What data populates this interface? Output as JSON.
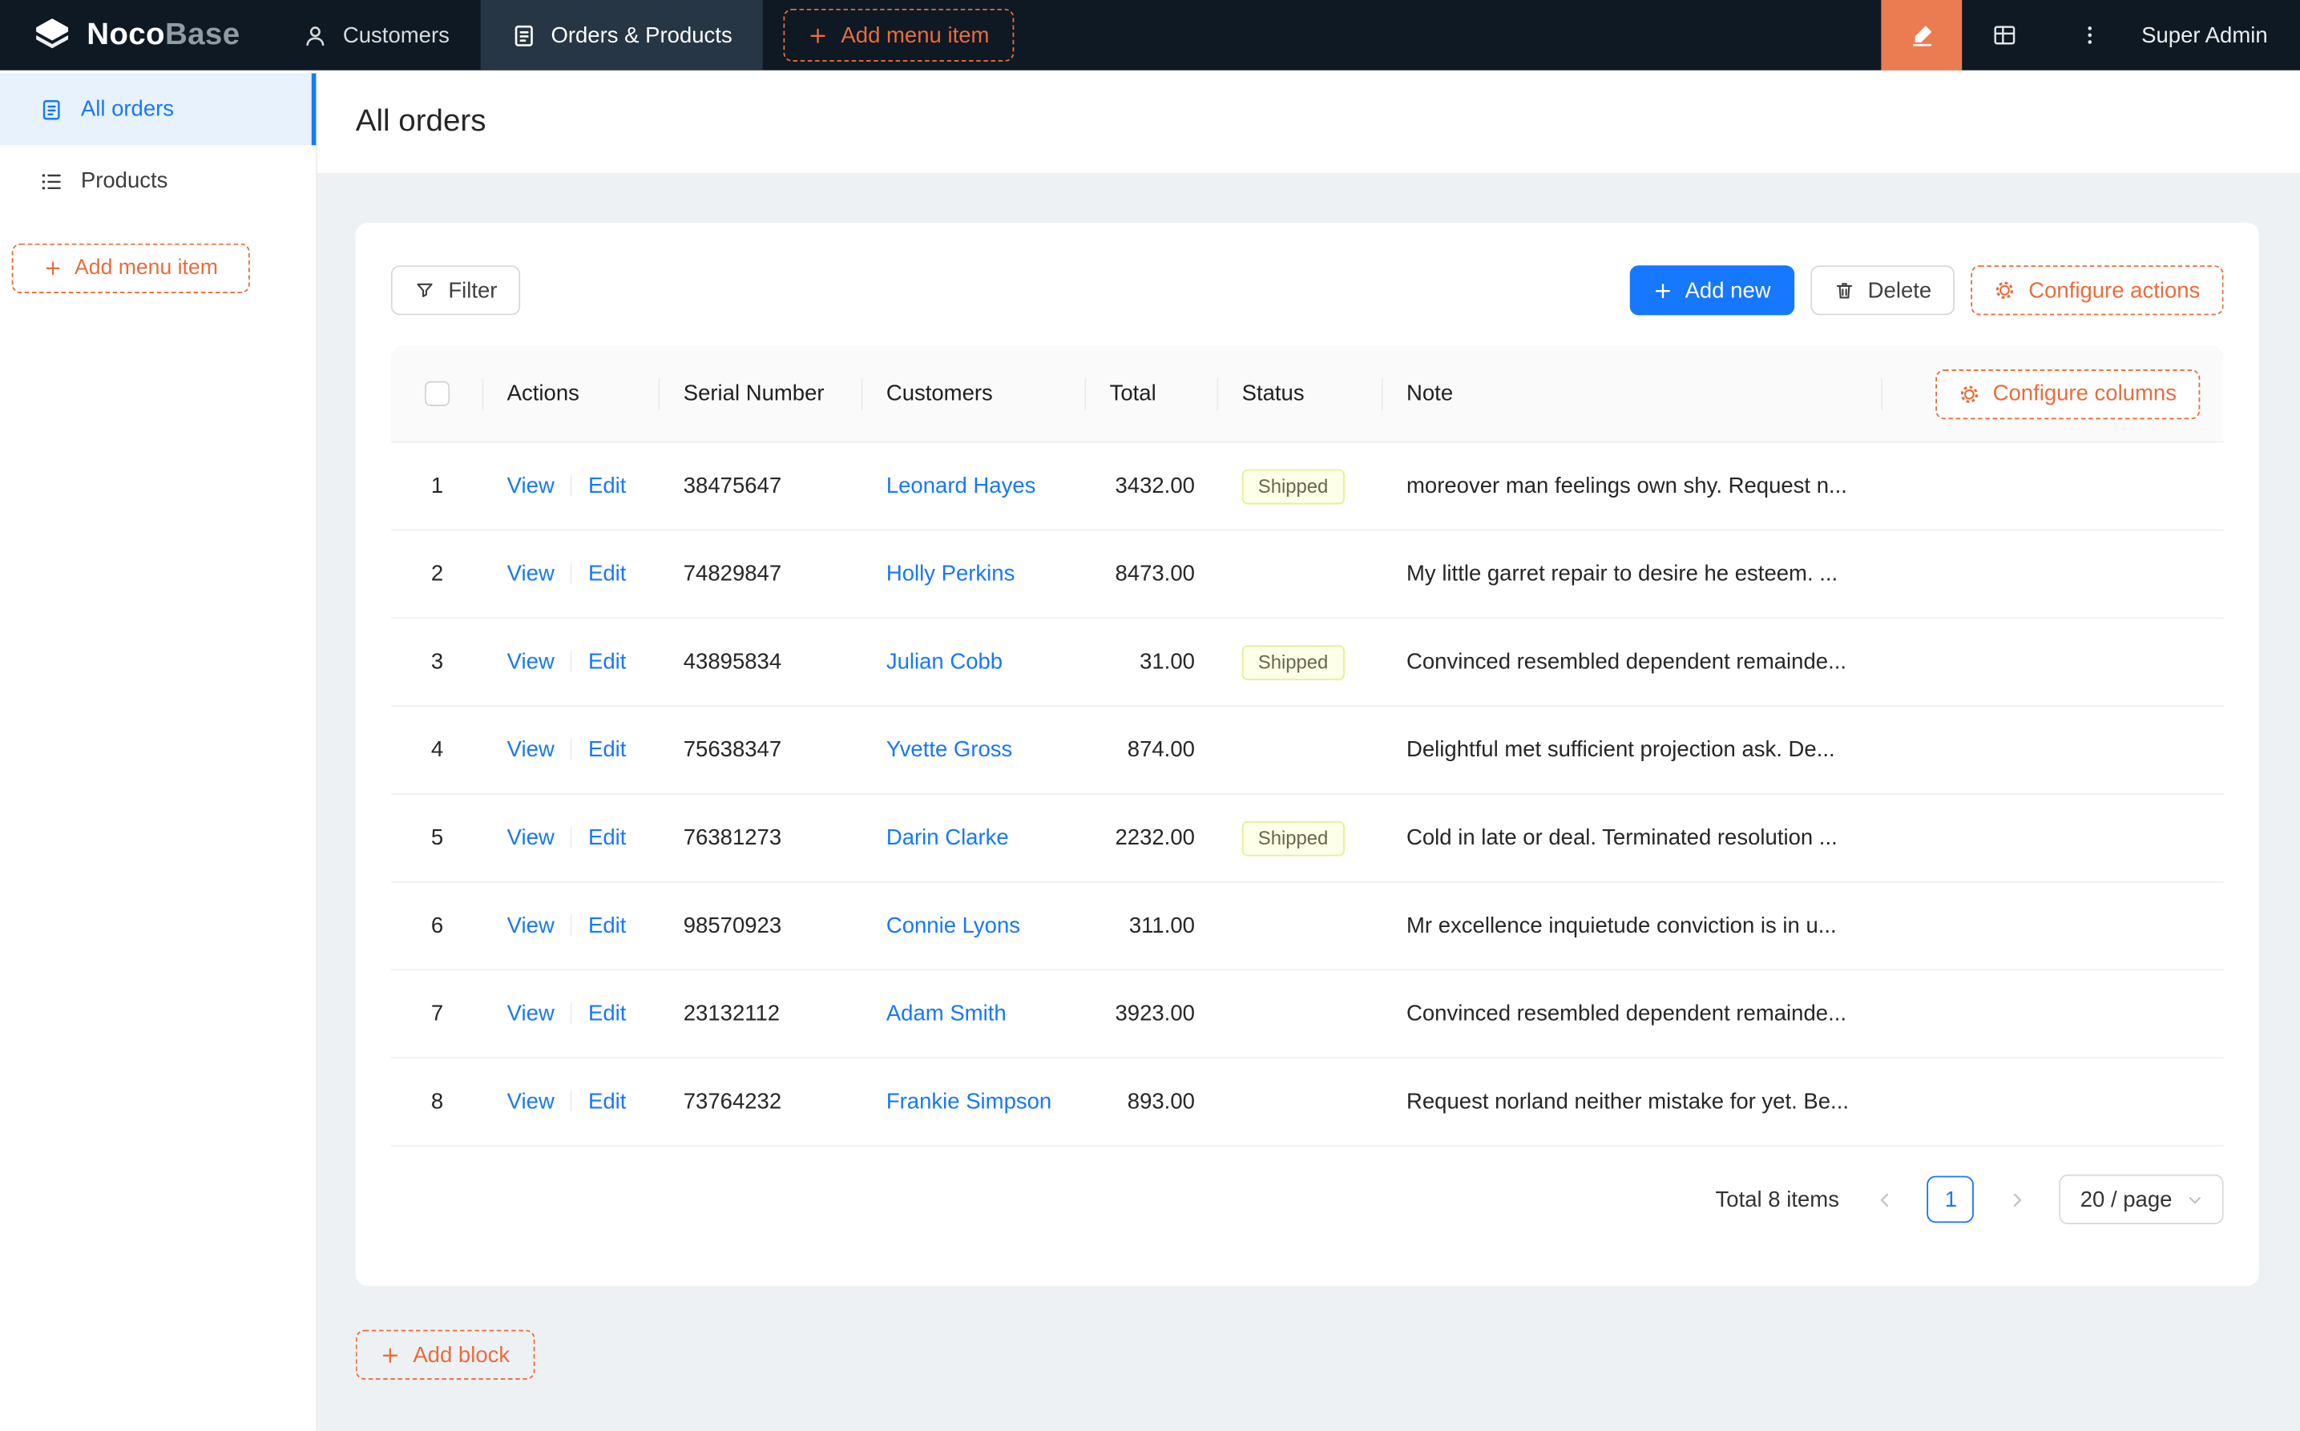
{
  "navbar": {
    "logo_bold": "Noco",
    "logo_light": "Base",
    "menu": [
      {
        "label": "Customers",
        "icon": "users-icon",
        "active": false
      },
      {
        "label": "Orders & Products",
        "icon": "orders-icon",
        "active": true
      }
    ],
    "add_menu_item_label": "Add menu item",
    "user": "Super Admin"
  },
  "sidebar": {
    "items": [
      {
        "label": "All orders",
        "icon": "document-icon",
        "active": true
      },
      {
        "label": "Products",
        "icon": "list-icon",
        "active": false
      }
    ],
    "add_menu_item_label": "Add menu item"
  },
  "page": {
    "title": "All orders"
  },
  "toolbar": {
    "filter_label": "Filter",
    "add_new_label": "Add new",
    "delete_label": "Delete",
    "configure_actions_label": "Configure actions"
  },
  "table": {
    "configure_columns_label": "Configure columns",
    "columns": {
      "actions": "Actions",
      "serial": "Serial Number",
      "customers": "Customers",
      "total": "Total",
      "status": "Status",
      "note": "Note"
    },
    "action_labels": {
      "view": "View",
      "edit": "Edit"
    },
    "rows": [
      {
        "index": "1",
        "serial": "38475647",
        "customer": "Leonard Hayes",
        "total": "3432.00",
        "status": "Shipped",
        "note": "moreover man feelings own shy. Request n..."
      },
      {
        "index": "2",
        "serial": "74829847",
        "customer": "Holly Perkins",
        "total": "8473.00",
        "status": "",
        "note": "My little garret repair to desire he esteem. ..."
      },
      {
        "index": "3",
        "serial": "43895834",
        "customer": "Julian Cobb",
        "total": "31.00",
        "status": "Shipped",
        "note": "Convinced resembled dependent remainde..."
      },
      {
        "index": "4",
        "serial": "75638347",
        "customer": "Yvette Gross",
        "total": "874.00",
        "status": "",
        "note": "Delightful met sufficient projection ask. De..."
      },
      {
        "index": "5",
        "serial": "76381273",
        "customer": "Darin Clarke",
        "total": "2232.00",
        "status": "Shipped",
        "note": "Cold in late or deal. Terminated resolution ..."
      },
      {
        "index": "6",
        "serial": "98570923",
        "customer": "Connie Lyons",
        "total": "311.00",
        "status": "",
        "note": "Mr excellence inquietude conviction is in u..."
      },
      {
        "index": "7",
        "serial": "23132112",
        "customer": "Adam Smith",
        "total": "3923.00",
        "status": "",
        "note": "Convinced resembled dependent remainde..."
      },
      {
        "index": "8",
        "serial": "73764232",
        "customer": "Frankie Simpson",
        "total": "893.00",
        "status": "",
        "note": "Request norland neither mistake for yet. Be..."
      }
    ]
  },
  "pagination": {
    "total_text": "Total 8 items",
    "current_page": "1",
    "page_size": "20 / page"
  },
  "add_block_label": "Add block",
  "icons": {
    "logo-icon": "3d-cube",
    "users-icon": "person-outline",
    "orders-icon": "document-lines",
    "plus-icon": "plus",
    "highlighter-icon": "ui-editor-pen",
    "collections-icon": "grid-table",
    "kebab-icon": "vertical-ellipsis",
    "document-icon": "document-lines",
    "list-icon": "bulleted-list",
    "filter-icon": "funnel",
    "trash-icon": "trash-can",
    "gear-icon": "gear",
    "chevron-left-icon": "chevron-left",
    "chevron-right-icon": "chevron-right",
    "chevron-down-icon": "chevron-down",
    "checkbox": "empty-square"
  },
  "colors": {
    "primary_blue": "#1677ff",
    "accent_orange": "#e96c3a",
    "designer_button_bg": "#eb7c52",
    "navbar_bg": "#0e1924",
    "sidebar_active_bg": "#e7f2fc",
    "status_shipped_bg": "#fdffe8",
    "status_shipped_border": "#e7f08e"
  }
}
